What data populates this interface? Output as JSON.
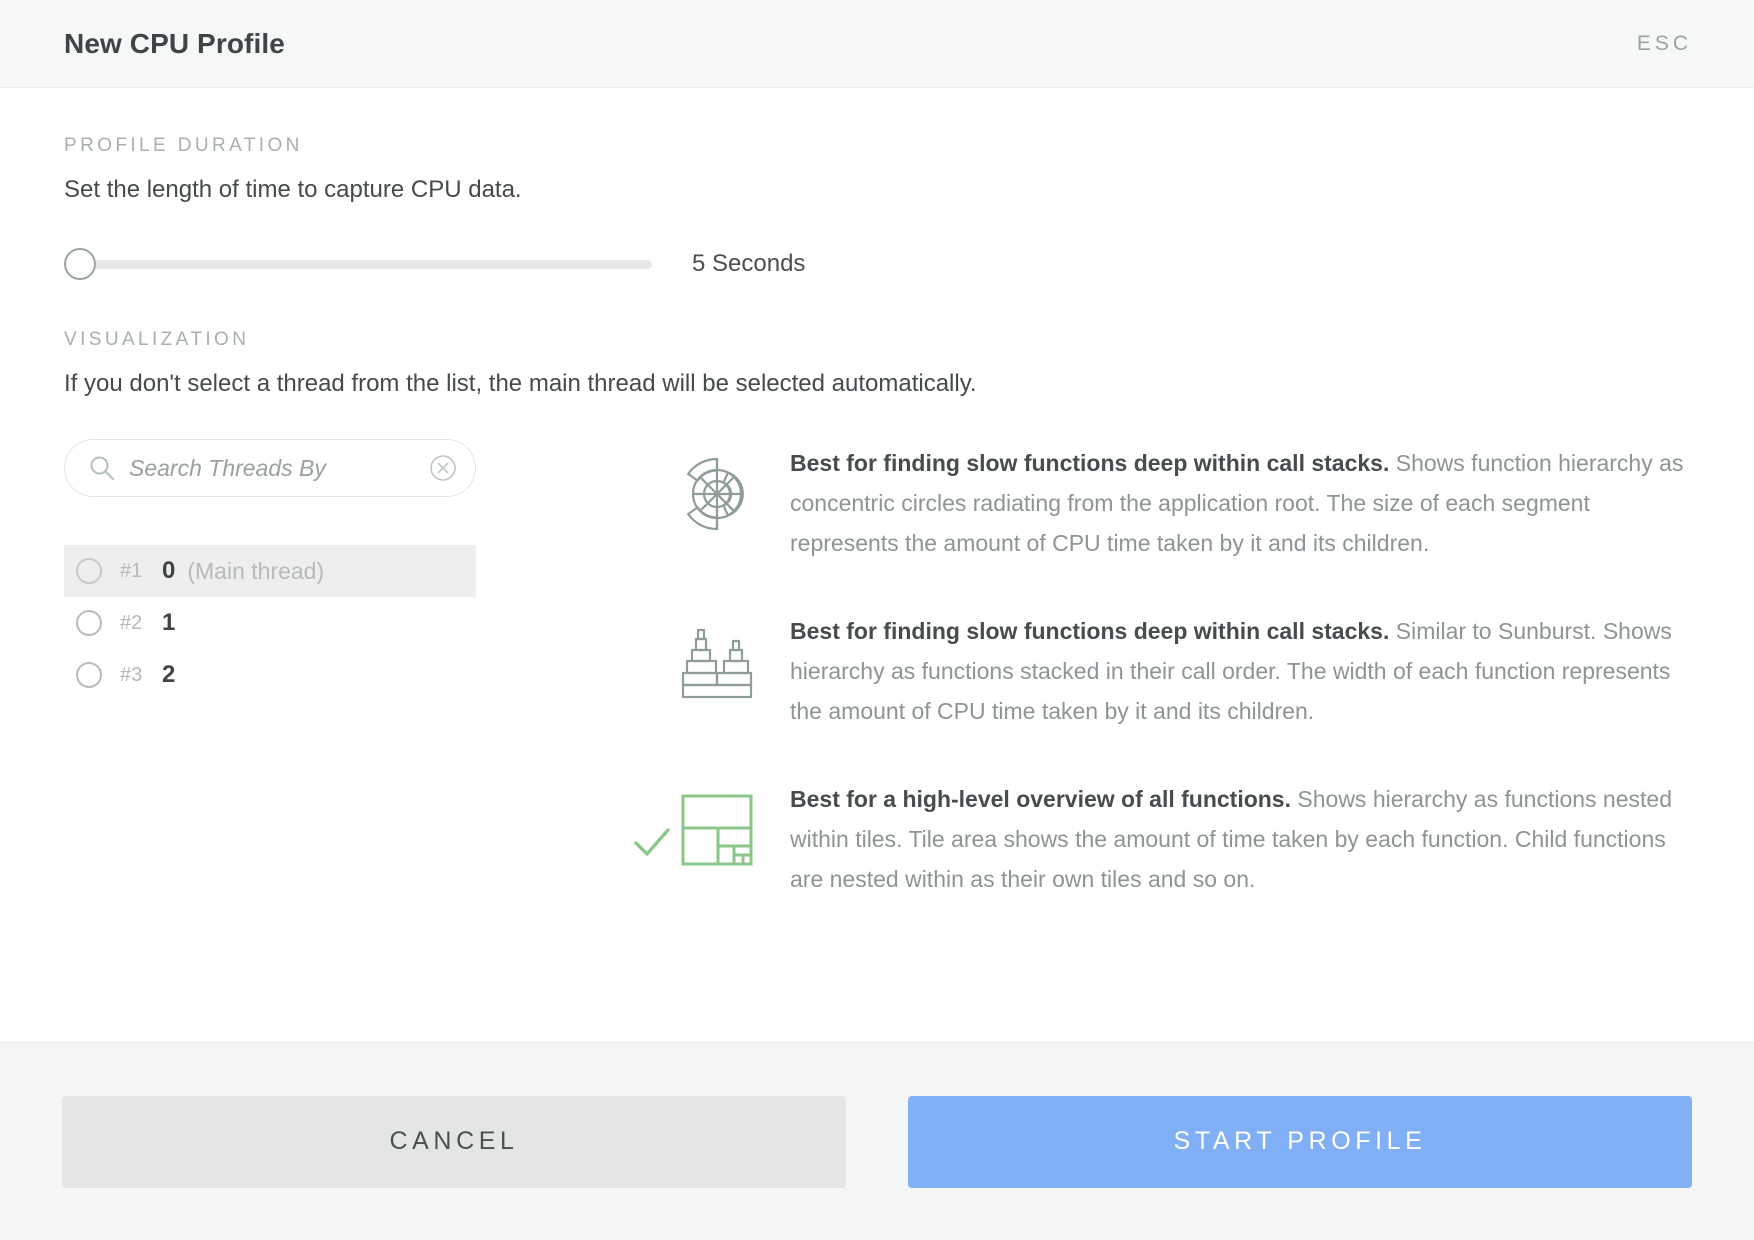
{
  "header": {
    "title": "New CPU Profile",
    "esc_label": "ESC"
  },
  "duration": {
    "section_label": "PROFILE DURATION",
    "description": "Set the length of time to capture CPU data.",
    "slider_value_label": "5 Seconds",
    "slider_min": 5,
    "slider_max": 60,
    "slider_current": 5,
    "slider_position_percent": 0
  },
  "visualization": {
    "section_label": "VISUALIZATION",
    "description": "If you don't select a thread from the list, the main thread will be selected automatically.",
    "search": {
      "placeholder": "Search Threads By",
      "value": "",
      "search_icon": "search-icon",
      "clear_icon": "clear-circle-icon"
    },
    "threads": [
      {
        "index": "#1",
        "id": "0",
        "note": "(Main thread)",
        "selected": true
      },
      {
        "index": "#2",
        "id": "1",
        "note": "",
        "selected": false
      },
      {
        "index": "#3",
        "id": "2",
        "note": "",
        "selected": false
      }
    ],
    "options": [
      {
        "icon": "sunburst-icon",
        "selected": false,
        "headline": "Best for finding slow functions deep within call stacks.",
        "body": " Shows function hierarchy as concentric circles radiating from the application root. The size of each segment represents the amount of CPU time taken by it and its children."
      },
      {
        "icon": "flame-chart-icon",
        "selected": false,
        "headline": "Best for finding slow functions deep within call stacks.",
        "body": " Similar to Sunburst. Shows hierarchy as functions stacked in their call order. The width of each function represents the amount of CPU time taken by it and its children."
      },
      {
        "icon": "treemap-icon",
        "selected": true,
        "headline": "Best for a high-level overview of all functions.",
        "body": " Shows hierarchy as functions nested within tiles. Tile area shows the amount of time taken by each function. Child functions are nested within as their own tiles and so on."
      }
    ]
  },
  "footer": {
    "cancel_label": "CANCEL",
    "start_label": "START PROFILE"
  },
  "colors": {
    "accent_blue": "#81aff5",
    "accent_green": "#8cc68a",
    "icon_gray": "#8e9c9a",
    "header_bg": "#f6f7f7",
    "footer_bg": "#f4f6f6"
  }
}
